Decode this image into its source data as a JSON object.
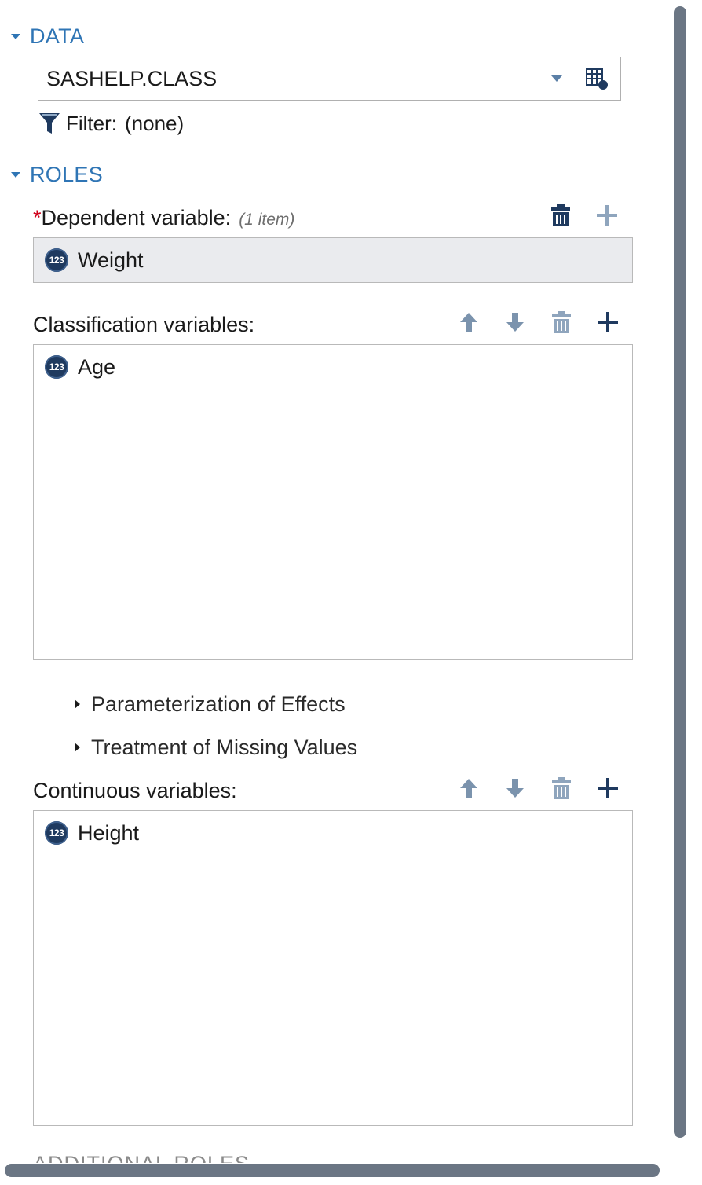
{
  "data_section": {
    "title": "DATA",
    "dataset": "SASHELP.CLASS",
    "filter_label": "Filter:",
    "filter_value": "(none)"
  },
  "roles_section": {
    "title": "ROLES",
    "dependent": {
      "required_marker": "*",
      "label": "Dependent variable:",
      "count": "(1 item)",
      "items": [
        "Weight"
      ]
    },
    "classification": {
      "label": "Classification variables:",
      "items": [
        "Age"
      ]
    },
    "expanders": [
      "Parameterization of Effects",
      "Treatment of Missing Values"
    ],
    "continuous": {
      "label": "Continuous variables:",
      "items": [
        "Height"
      ]
    }
  },
  "next_section_partial": "ADDITIONAL ROLES",
  "icons": {
    "numeric_variable": "123",
    "colors": {
      "accent": "#2f75b5",
      "dark_icon": "#1f3a5f",
      "muted_icon": "#7b93ad",
      "scrollbar": "#6b7684"
    }
  }
}
